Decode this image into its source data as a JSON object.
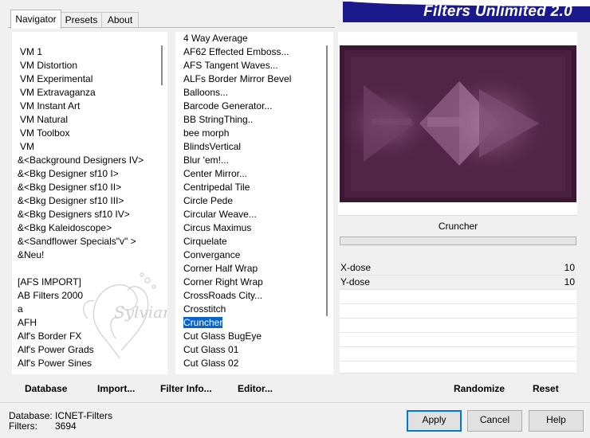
{
  "tabs": [
    "Navigator",
    "Presets",
    "About"
  ],
  "banner_title": "Filters Unlimited 2.0",
  "categories": [
    "VM 1",
    "VM Distortion",
    "VM Experimental",
    "VM Extravaganza",
    "VM Instant Art",
    "VM Natural",
    "VM Toolbox",
    "VM",
    "&<Background Designers IV>",
    "&<Bkg Designer sf10 I>",
    "&<Bkg Designer sf10 II>",
    "&<Bkg Designer sf10 III>",
    "&<Bkg Designers sf10 IV>",
    "&<Bkg Kaleidoscope>",
    "&<Sandflower Specials\"v\" >",
    "&Neu!",
    "",
    "[AFS IMPORT]",
    "AB Filters 2000",
    "a",
    "AFH",
    "Alf's Border FX",
    "Alf's Power Grads",
    "Alf's Power Sines"
  ],
  "filters": [
    "4 Way Average",
    "AF62 Effected Emboss...",
    "AFS Tangent Waves...",
    "ALFs Border Mirror Bevel",
    "Balloons...",
    "Barcode Generator...",
    "BB StringThing..",
    "bee morph",
    "BlindsVertical",
    "Blur 'em!...",
    "Center Mirror...",
    "Centripedal Tile",
    "Circle Pede",
    "Circular Weave...",
    "Circus Maximus",
    "Cirquelate",
    "Convergance",
    "Corner Half Wrap",
    "Corner Right Wrap",
    "CrossRoads City...",
    "Crosstitch",
    "Cruncher",
    "Cut Glass  BugEye",
    "Cut Glass 01",
    "Cut Glass 02"
  ],
  "selected_filter": "Cruncher",
  "params": [
    {
      "label": "X-dose",
      "value": "10"
    },
    {
      "label": "Y-dose",
      "value": "10"
    }
  ],
  "bottom_buttons": {
    "database": "Database",
    "import": "Import...",
    "filter_info": "Filter Info...",
    "editor": "Editor...",
    "randomize": "Randomize",
    "reset": "Reset"
  },
  "status": {
    "database_label": "Database:",
    "database_value": "ICNET-Filters",
    "filters_label": "Filters:",
    "filters_value": "3694"
  },
  "dialog_buttons": {
    "apply": "Apply",
    "cancel": "Cancel",
    "help": "Help"
  },
  "colors": {
    "banner": "#1a1a8c",
    "selection": "#0a64c8",
    "preview": "#4a2042"
  }
}
